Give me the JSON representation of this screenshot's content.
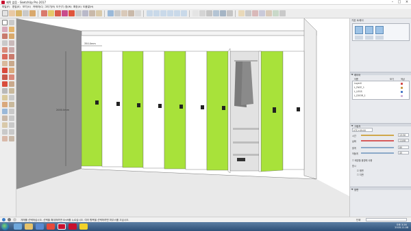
{
  "app": {
    "title": "제목 없음 - SketchUp Pro 2017"
  },
  "menu": [
    "파일(F)",
    "편집(E)",
    "보기(V)",
    "카메라(C)",
    "그리기(R)",
    "도구(T)",
    "창(W)",
    "확장(X)",
    "도움말(H)"
  ],
  "tray": {
    "title": "기본 트레이",
    "layers": {
      "heading": "레이어",
      "columns": {
        "name": "이름",
        "visible": "보기",
        "color": "색상"
      },
      "items": [
        {
          "name": "Layer0",
          "color": "#d44a4a"
        },
        {
          "name": "L_FACE_1",
          "color": "#c89a4a"
        },
        {
          "name": "L_LEGS",
          "color": "#4a7ac8"
        },
        {
          "name": "L_DOOR_1",
          "color": "#d2b4d8"
        }
      ]
    },
    "shadows": {
      "heading": "그림자",
      "utc": "UTC+09:00",
      "time_label": "시간",
      "date_label": "날짜",
      "light_label": "밝게",
      "dark_label": "어둡게",
      "time_value": "13:30",
      "date_value": "11/08",
      "light_value": "80",
      "dark_value": "45",
      "show_label": "표시",
      "face_option": "평면",
      "ground_option": "지면",
      "sun_option": "좋은 빛 화면에 대한 그림자",
      "use_sun": "태양을 음영에 사용"
    },
    "scenes": {
      "heading": "장면"
    }
  },
  "canvas": {
    "dim_width": "350.0mm",
    "dim_height": "2000.0mm"
  },
  "status": {
    "message": "개체를 선택하십시오. 선택을 확대하려면 Shift를 누르십시오. 여러 항목을 선택하려면 마우스를 끄십시오.",
    "unit_label": "단위"
  },
  "taskbar": {
    "time": "오후 3:26",
    "date": "2018-11-08"
  },
  "colors": {
    "lime": "#a8e23a",
    "panel_white": "#ffffff",
    "wall_gray": "#8f8f8f",
    "floor": "#e9e9e9",
    "handle": "#222222"
  }
}
